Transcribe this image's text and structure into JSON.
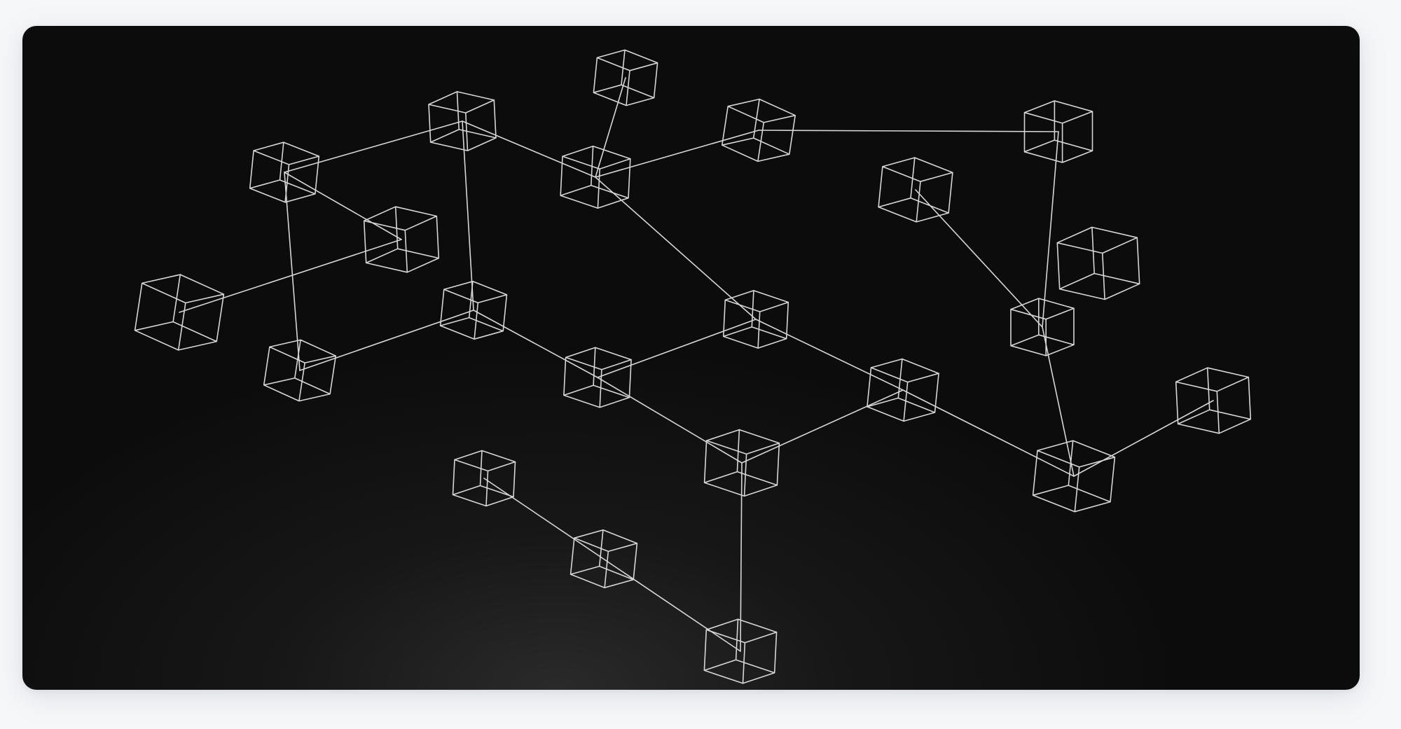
{
  "scene": {
    "description_hidden": "",
    "stroke_color": "#d6d6d6",
    "background_colors": [
      "#0c0c0c",
      "#171717",
      "#2a2a2a"
    ],
    "cube_count": 22,
    "link_count": 21
  }
}
